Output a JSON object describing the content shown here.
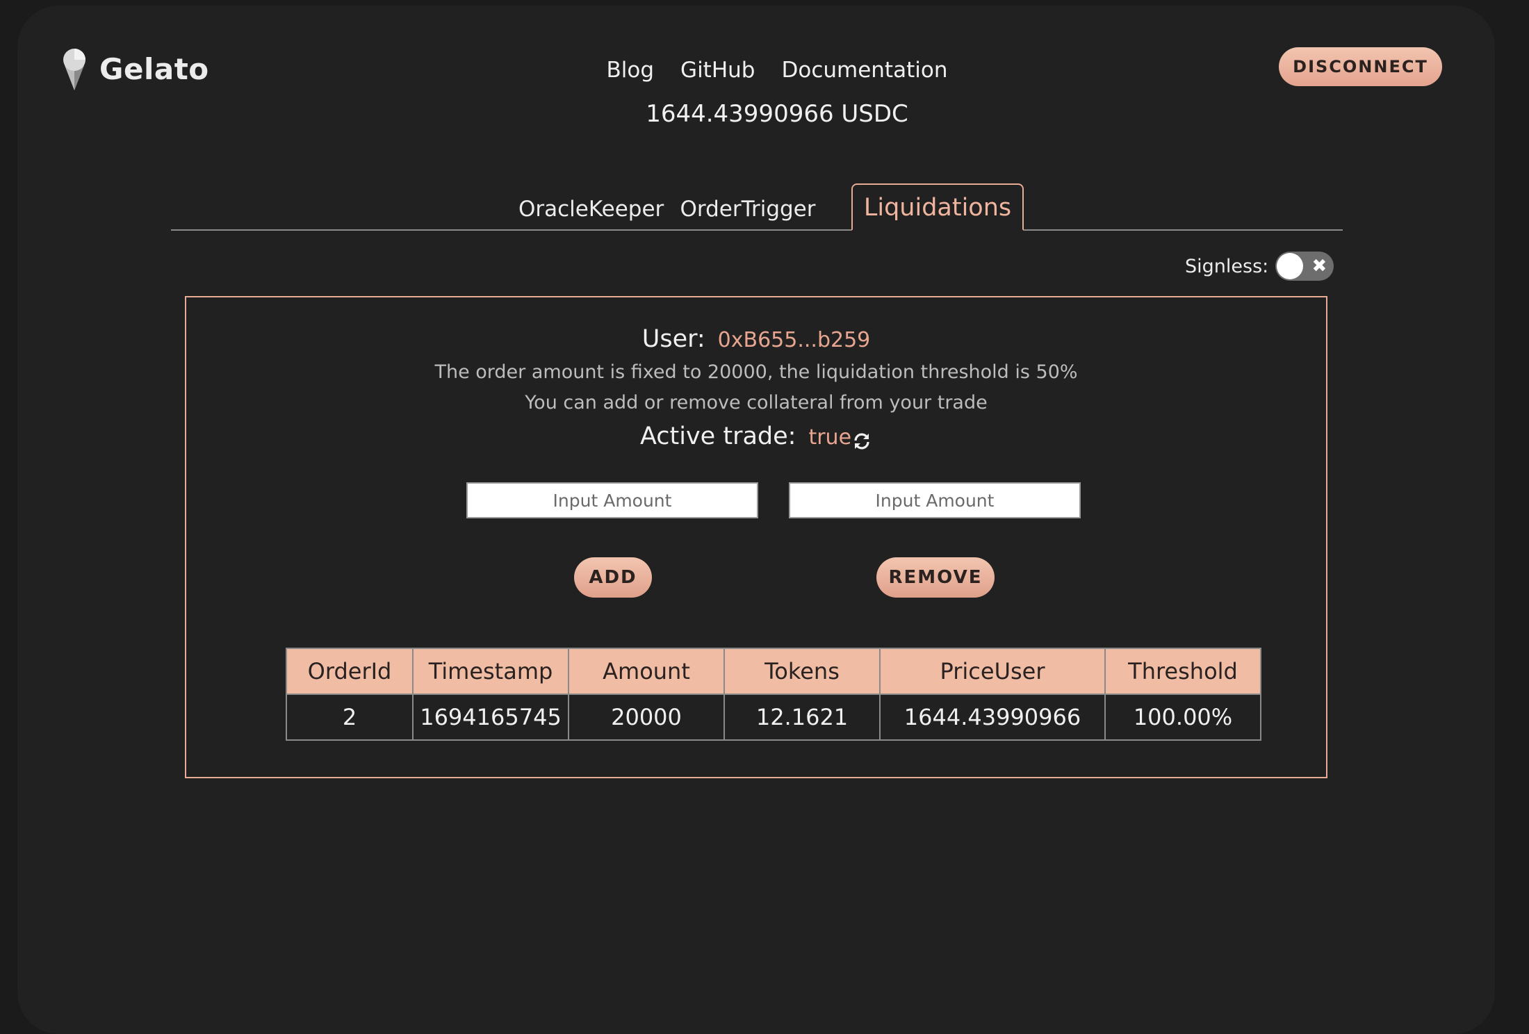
{
  "brand": {
    "name": "Gelato"
  },
  "nav": {
    "blog": "Blog",
    "github": "GitHub",
    "docs": "Documentation"
  },
  "header": {
    "balance": "1644.43990966 USDC",
    "disconnect_label": "DISCONNECT"
  },
  "tabs": [
    {
      "label": "OracleKeeper",
      "active": false
    },
    {
      "label": "OrderTrigger",
      "active": false
    },
    {
      "label": "Liquidations",
      "active": true
    }
  ],
  "signless": {
    "label": "Signless:",
    "enabled": false
  },
  "panel": {
    "user_label": "User:",
    "user_address": "0xB655...b259",
    "info_line_1": "The order amount is fixed to 20000, the liquidation threshold is 50%",
    "info_line_2": "You can add or remove collateral from your trade",
    "active_trade_label": "Active trade:",
    "active_trade_value": "true",
    "add_input": {
      "placeholder": "Input Amount",
      "value": ""
    },
    "remove_input": {
      "placeholder": "Input Amount",
      "value": ""
    },
    "add_label": "ADD",
    "remove_label": "REMOVE"
  },
  "table": {
    "columns": [
      "OrderId",
      "Timestamp",
      "Amount",
      "Tokens",
      "PriceUser",
      "Threshold"
    ],
    "rows": [
      [
        "2",
        "1694165745",
        "20000",
        "12.1621",
        "1644.43990966",
        "100.00%"
      ]
    ]
  },
  "colors": {
    "accent": "#e8ac95",
    "background": "#212121",
    "table_header": "#f0bca4"
  },
  "icons": {
    "logo": "gelato-icecream-icon",
    "refresh": "refresh-icon",
    "toggle_off": "close-icon"
  }
}
